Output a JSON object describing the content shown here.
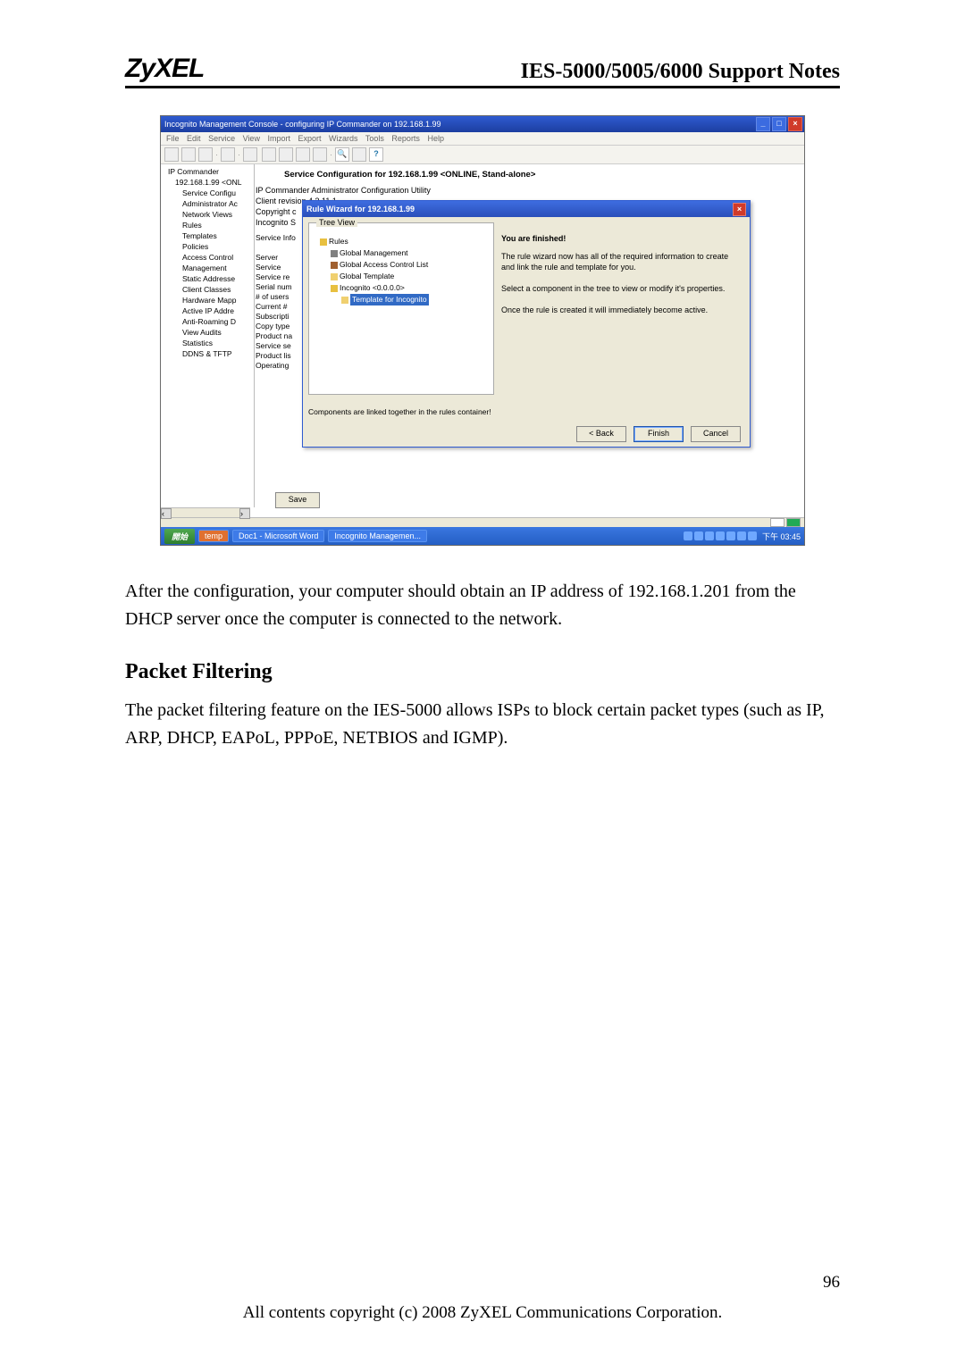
{
  "header": {
    "logo": "ZyXEL",
    "title": "IES-5000/5005/6000 Support Notes"
  },
  "screenshot": {
    "window_title": "Incognito Management Console - configuring IP Commander on 192.168.1.99",
    "menus": [
      "File",
      "Edit",
      "Service",
      "View",
      "Import",
      "Export",
      "Wizards",
      "Tools",
      "Reports",
      "Help"
    ],
    "tree": {
      "root": "IP Commander",
      "items": [
        "192.168.1.99 <ONL",
        "Service Configu",
        "Administrator Ac",
        "Network Views",
        "Rules",
        "Templates",
        "Policies",
        "Access Control",
        "Management",
        "Static Addresse",
        "Client Classes",
        "Hardware Mapp",
        "Active IP Addre",
        "Anti-Roaming D",
        "View Audits",
        "Statistics",
        "DDNS & TFTP"
      ]
    },
    "right": {
      "title": "Service Configuration for 192.168.1.99 <ONLINE, Stand-alone>",
      "line1": "IP Commander Administrator Configuration Utility",
      "line2": "Client revision 4.3.11.1",
      "line3_label": "Copyright c",
      "line4": "Incognito S",
      "info_left": [
        "Service Info",
        "",
        "Server",
        "Service",
        "Service re",
        "Serial num",
        "# of users",
        "Current #",
        "Subscripti",
        "Copy type",
        "Product na",
        "Service se",
        "Product lis",
        "Operating"
      ],
      "save": "Save"
    },
    "wizard": {
      "title": "Rule Wizard for 192.168.1.99",
      "fieldset_label": "Tree View",
      "tree": {
        "root": "Rules",
        "children": [
          "Global Management",
          "Global Access Control List",
          "Global Template",
          "Incognito <0.0.0.0>"
        ],
        "selected": "Template for Incognito"
      },
      "left_hint": "Components are linked together in the rules container!",
      "right_heading": "You are finished!",
      "right_p1": "The rule wizard now has all of the required information to create and link the rule and template for you.",
      "right_p2": "Select a component in the tree to view or modify it's properties.",
      "right_p3": "Once the rule is created it will immediately become active.",
      "buttons": {
        "back": "< Back",
        "finish": "Finish",
        "cancel": "Cancel"
      }
    },
    "taskbar": {
      "start": "開始",
      "quick": "temp",
      "tasks": [
        "Doc1 - Microsoft Word",
        "Incognito Managemen..."
      ],
      "clock": "下午 03:45"
    }
  },
  "body": {
    "para1": "After the configuration, your computer should obtain an IP address of 192.168.1.201 from the DHCP server once the computer is connected to the network.",
    "heading": "Packet Filtering",
    "para2": "The packet filtering feature on the IES-5000 allows ISPs to block certain packet types (such as IP, ARP, DHCP, EAPoL, PPPoE, NETBIOS and IGMP)."
  },
  "footer": {
    "page": "96",
    "copyright": "All contents copyright (c) 2008 ZyXEL Communications Corporation."
  }
}
